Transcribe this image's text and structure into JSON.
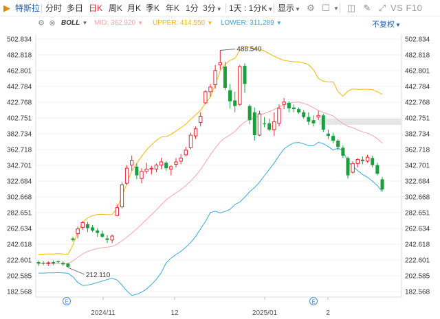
{
  "toolbar": {
    "flag_icon": "flag-icon",
    "stock_name": "特斯拉",
    "periods": [
      "分时",
      "多日",
      "日K",
      "周K",
      "月K",
      "季K",
      "年K",
      "1分",
      "3分"
    ],
    "active_period": "日K",
    "range_select": "1天 : 1分K",
    "display_label": "显示",
    "vs_label": "VS",
    "f10_label": "F10"
  },
  "indicator": {
    "name": "BOLL",
    "mid_label": "MID:",
    "mid_value": "362.920",
    "upper_label": "UPPER:",
    "upper_value": "414.550",
    "lower_label": "LOWER:",
    "lower_value": "311.289",
    "adjust_label": "不复权",
    "colors": {
      "mid": "#f4a5a5",
      "upper": "#f5b800",
      "lower": "#38a8d8",
      "up": "#e8232f",
      "down": "#1c9e3f"
    }
  },
  "chart_data": {
    "type": "candlestick",
    "y_ticks": [
      "502.834",
      "482.818",
      "462.801",
      "442.784",
      "422.768",
      "402.751",
      "382.734",
      "362.718",
      "342.701",
      "322.684",
      "302.668",
      "282.651",
      "262.634",
      "242.618",
      "222.601",
      "202.585",
      "182.568"
    ],
    "ylim": [
      182.568,
      502.834
    ],
    "x_labels": [
      "2024/11",
      "12",
      "2025/01",
      "2"
    ],
    "annotations": {
      "max_label": "488.540",
      "min_label": "212.110"
    },
    "event_markers": [
      "E",
      "E"
    ],
    "candles": [
      {
        "o": 220,
        "h": 222,
        "l": 215,
        "c": 218
      },
      {
        "o": 219,
        "h": 221,
        "l": 216,
        "c": 218
      },
      {
        "o": 218,
        "h": 221,
        "l": 215,
        "c": 219
      },
      {
        "o": 220,
        "h": 222,
        "l": 216,
        "c": 218
      },
      {
        "o": 221,
        "h": 222,
        "l": 218,
        "c": 220
      },
      {
        "o": 219,
        "h": 221,
        "l": 215,
        "c": 217
      },
      {
        "o": 218,
        "h": 219,
        "l": 213,
        "c": 214
      },
      {
        "o": 250,
        "h": 252,
        "l": 246,
        "c": 248
      },
      {
        "o": 256,
        "h": 265,
        "l": 250,
        "c": 262
      },
      {
        "o": 264,
        "h": 272,
        "l": 261,
        "c": 270
      },
      {
        "o": 268,
        "h": 271,
        "l": 258,
        "c": 263
      },
      {
        "o": 264,
        "h": 267,
        "l": 258,
        "c": 260
      },
      {
        "o": 260,
        "h": 263,
        "l": 252,
        "c": 257
      },
      {
        "o": 256,
        "h": 260,
        "l": 251,
        "c": 252
      },
      {
        "o": 250,
        "h": 254,
        "l": 244,
        "c": 248
      },
      {
        "o": 248,
        "h": 255,
        "l": 244,
        "c": 253
      },
      {
        "o": 279,
        "h": 293,
        "l": 278,
        "c": 289
      },
      {
        "o": 290,
        "h": 321,
        "l": 288,
        "c": 318
      },
      {
        "o": 320,
        "h": 343,
        "l": 318,
        "c": 339
      },
      {
        "o": 343,
        "h": 355,
        "l": 336,
        "c": 349
      },
      {
        "o": 341,
        "h": 345,
        "l": 325,
        "c": 330
      },
      {
        "o": 326,
        "h": 339,
        "l": 320,
        "c": 335
      },
      {
        "o": 335,
        "h": 346,
        "l": 332,
        "c": 338
      },
      {
        "o": 338,
        "h": 342,
        "l": 331,
        "c": 339
      },
      {
        "o": 338,
        "h": 345,
        "l": 334,
        "c": 343
      },
      {
        "o": 343,
        "h": 352,
        "l": 338,
        "c": 347
      },
      {
        "o": 346,
        "h": 348,
        "l": 336,
        "c": 339
      },
      {
        "o": 338,
        "h": 343,
        "l": 330,
        "c": 341
      },
      {
        "o": 344,
        "h": 352,
        "l": 340,
        "c": 347
      },
      {
        "o": 348,
        "h": 357,
        "l": 344,
        "c": 352
      },
      {
        "o": 356,
        "h": 366,
        "l": 354,
        "c": 362
      },
      {
        "o": 365,
        "h": 384,
        "l": 363,
        "c": 381
      },
      {
        "o": 380,
        "h": 392,
        "l": 376,
        "c": 389
      },
      {
        "o": 397,
        "h": 410,
        "l": 392,
        "c": 405
      },
      {
        "o": 422,
        "h": 438,
        "l": 420,
        "c": 436
      },
      {
        "o": 436,
        "h": 446,
        "l": 430,
        "c": 442
      },
      {
        "o": 445,
        "h": 470,
        "l": 440,
        "c": 463
      },
      {
        "o": 470,
        "h": 488.54,
        "l": 464,
        "c": 473
      },
      {
        "o": 468,
        "h": 474,
        "l": 438,
        "c": 441
      },
      {
        "o": 438,
        "h": 446,
        "l": 415,
        "c": 424
      },
      {
        "o": 425,
        "h": 436,
        "l": 410,
        "c": 418
      },
      {
        "o": 420,
        "h": 470,
        "l": 418,
        "c": 468
      },
      {
        "o": 469,
        "h": 472,
        "l": 435,
        "c": 446
      },
      {
        "o": 418,
        "h": 420,
        "l": 395,
        "c": 400
      },
      {
        "o": 410,
        "h": 416,
        "l": 374,
        "c": 381
      },
      {
        "o": 381,
        "h": 412,
        "l": 380,
        "c": 408
      },
      {
        "o": 396,
        "h": 404,
        "l": 391,
        "c": 395
      },
      {
        "o": 396,
        "h": 402,
        "l": 386,
        "c": 388
      },
      {
        "o": 388,
        "h": 410,
        "l": 380,
        "c": 398
      },
      {
        "o": 396,
        "h": 420,
        "l": 392,
        "c": 415
      },
      {
        "o": 420,
        "h": 428,
        "l": 414,
        "c": 423
      },
      {
        "o": 422,
        "h": 424,
        "l": 410,
        "c": 415
      },
      {
        "o": 416,
        "h": 420,
        "l": 410,
        "c": 414
      },
      {
        "o": 414,
        "h": 416,
        "l": 408,
        "c": 410
      },
      {
        "o": 410,
        "h": 413,
        "l": 402,
        "c": 404
      },
      {
        "o": 404,
        "h": 410,
        "l": 394,
        "c": 398
      },
      {
        "o": 400,
        "h": 406,
        "l": 392,
        "c": 396
      },
      {
        "o": 404,
        "h": 412,
        "l": 400,
        "c": 406
      },
      {
        "o": 406,
        "h": 408,
        "l": 385,
        "c": 388
      },
      {
        "o": 383,
        "h": 388,
        "l": 376,
        "c": 380
      },
      {
        "o": 380,
        "h": 384,
        "l": 371,
        "c": 374
      },
      {
        "o": 374,
        "h": 376,
        "l": 362,
        "c": 366
      },
      {
        "o": 365,
        "h": 368,
        "l": 352,
        "c": 355
      },
      {
        "o": 352,
        "h": 354,
        "l": 326,
        "c": 330
      },
      {
        "o": 334,
        "h": 348,
        "l": 332,
        "c": 345
      },
      {
        "o": 345,
        "h": 352,
        "l": 340,
        "c": 350
      },
      {
        "o": 350,
        "h": 354,
        "l": 344,
        "c": 348
      },
      {
        "o": 348,
        "h": 356,
        "l": 346,
        "c": 353
      },
      {
        "o": 352,
        "h": 355,
        "l": 340,
        "c": 343
      },
      {
        "o": 343,
        "h": 346,
        "l": 330,
        "c": 332
      },
      {
        "o": 325,
        "h": 328,
        "l": 310,
        "c": 312
      }
    ]
  }
}
